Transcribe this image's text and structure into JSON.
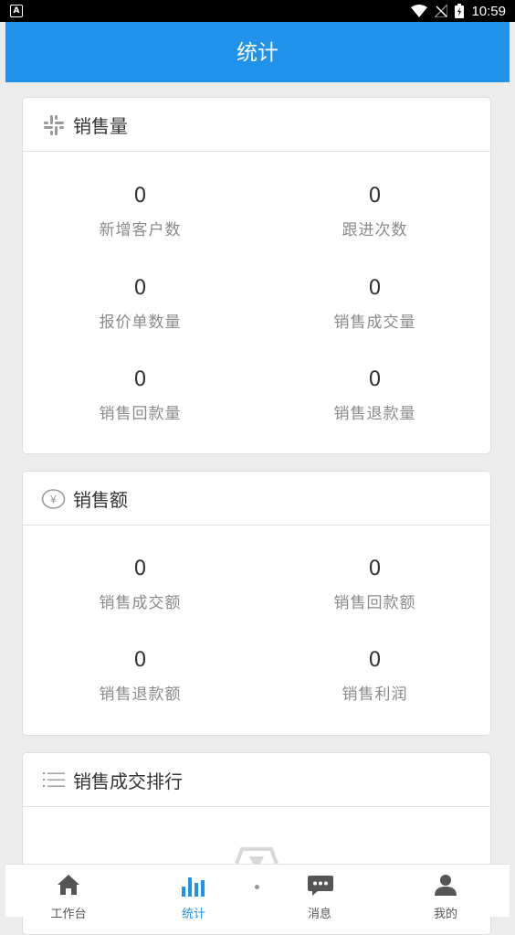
{
  "status_bar": {
    "notif": "A",
    "time": "10:59"
  },
  "header": {
    "title": "统计"
  },
  "sales_volume": {
    "title": "销售量",
    "items": [
      {
        "value": "0",
        "label": "新增客户数"
      },
      {
        "value": "0",
        "label": "跟进次数"
      },
      {
        "value": "0",
        "label": "报价单数量"
      },
      {
        "value": "0",
        "label": "销售成交量"
      },
      {
        "value": "0",
        "label": "销售回款量"
      },
      {
        "value": "0",
        "label": "销售退款量"
      }
    ]
  },
  "sales_amount": {
    "title": "销售额",
    "items": [
      {
        "value": "0",
        "label": "销售成交额"
      },
      {
        "value": "0",
        "label": "销售回款额"
      },
      {
        "value": "0",
        "label": "销售退款额"
      },
      {
        "value": "0",
        "label": "销售利润"
      }
    ]
  },
  "ranking": {
    "title": "销售成交排行"
  },
  "tabs": [
    {
      "label": "工作台"
    },
    {
      "label": "统计"
    },
    {
      "label": "消息"
    },
    {
      "label": "我的"
    }
  ],
  "colors": {
    "primary": "#2192ea",
    "background": "#ececec"
  }
}
